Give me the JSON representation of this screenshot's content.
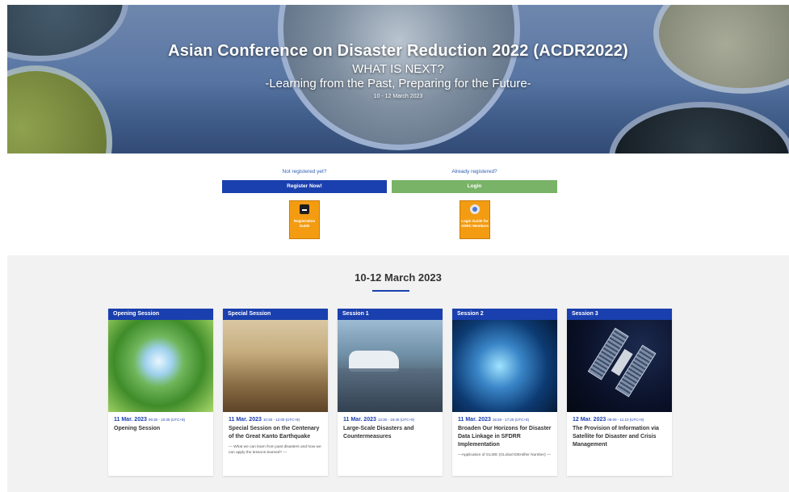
{
  "hero": {
    "title": "Asian Conference on Disaster Reduction 2022 (ACDR2022)",
    "subtitle1": "WHAT IS NEXT?",
    "subtitle2": "-Learning from the Past, Preparing for the Future-",
    "dates": "10 - 12 March 2023"
  },
  "registration": {
    "not_registered": "Not registered yet?",
    "already_registered": "Already registered?",
    "register_button": "Register Now!",
    "login_button": "Login",
    "registration_guide": "Registration Guide",
    "login_guide": "Login Guide for ADRC Members",
    "colors": {
      "register": "#1a3fae",
      "login": "#78b368",
      "guide": "#f39c12"
    }
  },
  "sessions_section": {
    "title": "10-12 March 2023",
    "cards": [
      {
        "label": "Opening Session",
        "date": "11 Mar. 2023",
        "time": "09:30 - 10:30 (UTC+9)",
        "title": "Opening Session",
        "subtitle": ""
      },
      {
        "label": "Special Session",
        "date": "11 Mar. 2023",
        "time": "10:30 - 12:00 (UTC+9)",
        "title": "Special Session on the Centenary of the Great Kanto Earthquake",
        "subtitle": "— What we can learn from past disasters and how we can apply the lessons learned? —"
      },
      {
        "label": "Session 1",
        "date": "11 Mar. 2023",
        "time": "13:30 - 15:40 (UTC+9)",
        "title": "Large-Scale Disasters and Countermeasures",
        "subtitle": ""
      },
      {
        "label": "Session 2",
        "date": "11 Mar. 2023",
        "time": "15:50 - 17:20 (UTC+9)",
        "title": "Broaden Our Horizons for Disaster Data Linkage in SFDRR Implementation",
        "subtitle": "—Application of GLIDE (GLobal IDEntifier Number) —"
      },
      {
        "label": "Session 3",
        "date": "12 Mar. 2023",
        "time": "09:00 - 11:10 (UTC+9)",
        "title": "The Provision of Information via Satellite for Disaster and Crisis Management",
        "subtitle": ""
      }
    ]
  }
}
